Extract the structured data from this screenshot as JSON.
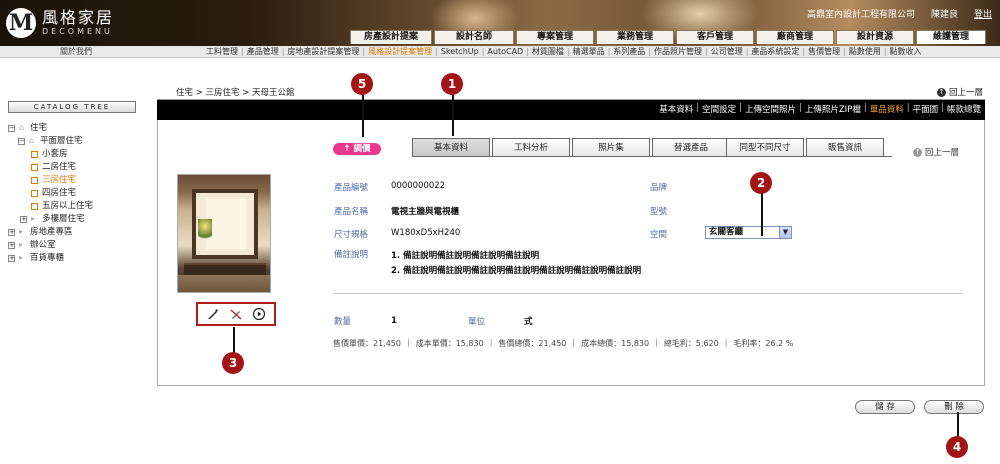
{
  "header": {
    "logo_mark": "M",
    "logo_cn": "風格家居",
    "logo_en": "DECOMENU",
    "company": "高鼎室內設計工程有限公司",
    "user": "陳建良",
    "logout": "登出",
    "main_tabs": [
      "房產設計提案",
      "設計名師",
      "專案管理",
      "業務管理",
      "客戶管理",
      "廠商管理",
      "設計資源",
      "維護管理"
    ],
    "active_tab": "維護管理"
  },
  "submenu": {
    "about": "關於我們",
    "items": [
      "工料管理",
      "產品管理",
      "房地產設計提案管理",
      "風格設計提案管理",
      "SketchUp",
      "AutoCAD",
      "材質圖檔",
      "精選單品",
      "系列產品",
      "作品照片管理",
      "公司管理",
      "產品系統設定",
      "售價管理",
      "點數使用",
      "點數收入"
    ],
    "active": "風格設計提案管理"
  },
  "sidebar": {
    "title": "CATALOG TREE",
    "tree": [
      {
        "label": "住宅",
        "expander": "⊟"
      },
      {
        "label": "平面層住宅",
        "expander": "⊟"
      },
      {
        "label": "小套房"
      },
      {
        "label": "二房住宅"
      },
      {
        "label": "三房住宅"
      },
      {
        "label": "四房住宅"
      },
      {
        "label": "五房以上住宅"
      },
      {
        "label": "多樓層住宅",
        "expander": "⊞"
      },
      {
        "label": "房地產專區",
        "expander": "⊞"
      },
      {
        "label": "辦公室",
        "expander": "⊞"
      },
      {
        "label": "百貨專櫃",
        "expander": "⊞"
      }
    ],
    "selected": "三房住宅"
  },
  "content": {
    "breadcrumb": "住宅 > 三房住宅 > 天母王公館",
    "back_up": "回上一層",
    "action_links": [
      "基本資料",
      "空間設定",
      "上傳空間照片",
      "上傳照片ZIP檔",
      "單品資料",
      "平面圖",
      "帳款總覽"
    ],
    "active_action": "單品資料",
    "price_button": "↑ 調價",
    "tabs": [
      "基本資料",
      "工料分析",
      "照片集",
      "替選產品",
      "同型不同尺寸",
      "販售資訊"
    ],
    "active_detail_tab": "基本資料",
    "back_tab": "回上一層"
  },
  "product": {
    "code_label": "產品編號",
    "code": "0000000022",
    "name_label": "產品名稱",
    "name": "電視主牆與電視櫃",
    "size_label": "尺寸規格",
    "size": "W180xD5xH240",
    "note_label": "備註說明",
    "notes": [
      "1. 備註說明備註說明備註說明備註說明",
      "2. 備註說明備註說明備註說明備註說明備註說明備註說明備註說明"
    ],
    "brand_label": "品牌",
    "model_label": "型號",
    "space_label": "空間",
    "space_value": "玄關客廳",
    "qty_label": "數量",
    "qty": "1",
    "unit_label": "單位",
    "unit": "式",
    "stats": [
      "售價單價：21,450",
      "成本單價：15,830",
      "售價總價：21,450",
      "成本總價：15,830",
      "總毛利：5,620",
      "毛利率：26.2 %"
    ]
  },
  "buttons": {
    "save": "儲 存",
    "delete": "刪 除"
  },
  "markers": [
    "1",
    "2",
    "3",
    "4",
    "5"
  ],
  "colors": {
    "accent_orange": "#e07a00",
    "price_pink": "#e8378d",
    "marker_red": "#a31414",
    "label_blue": "#4d6aa5"
  },
  "icons": [
    "pen-icon",
    "no-edit-icon",
    "play-circle-icon"
  ]
}
